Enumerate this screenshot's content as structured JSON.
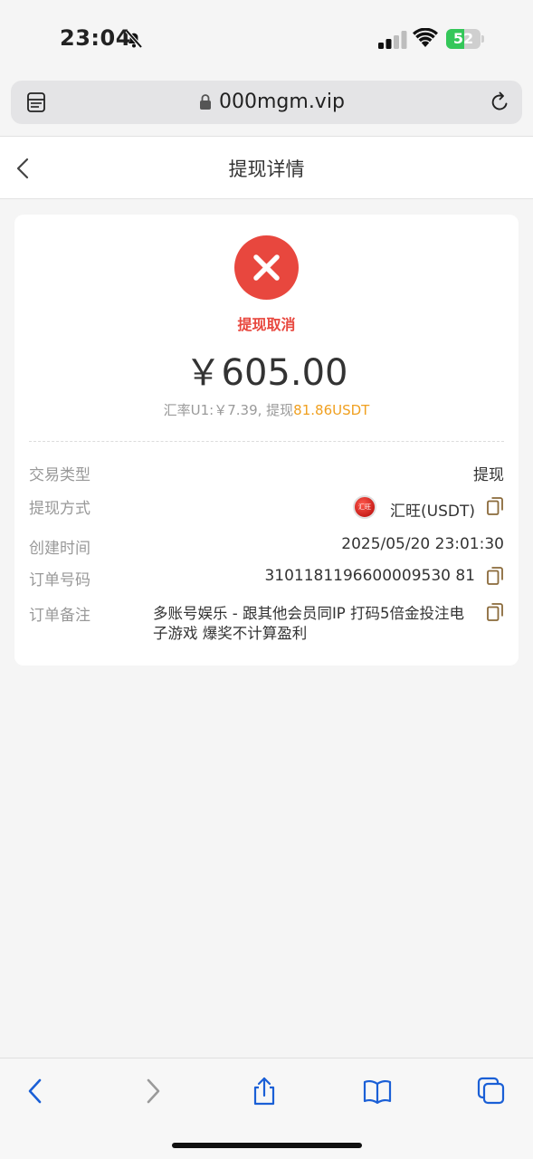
{
  "status_bar": {
    "time": "23:04",
    "battery": 52,
    "battery_label": "52"
  },
  "browser": {
    "url": "000mgm.vip"
  },
  "nav": {
    "title": "提现详情"
  },
  "detail": {
    "status": "提现取消",
    "amount": "￥605.00",
    "rate_prefix": "汇率U1:￥7.39, 提现",
    "rate_usdt": "81.86USDT",
    "rows": {
      "type": {
        "label": "交易类型",
        "value": "提现"
      },
      "method": {
        "label": "提现方式",
        "value": "汇旺(USDT)",
        "logo_text": "汇旺"
      },
      "created": {
        "label": "创建时间",
        "value": "2025/05/20 23:01:30"
      },
      "order_no": {
        "label": "订单号码",
        "value": "3101181196600009530 81"
      },
      "note": {
        "label": "订单备注",
        "value": "多账号娱乐 - 跟其他会员同IP 打码5倍金投注电子游戏 爆奖不计算盈利"
      }
    }
  },
  "colors": {
    "accent_red": "#e8473e",
    "usdt_orange": "#f0a020",
    "ios_blue": "#1a5fd6",
    "copy_brown": "#8a6a3a"
  },
  "icons": {
    "bell": "bell-slash-icon",
    "signal": "signal-icon",
    "wifi": "wifi-icon",
    "battery": "battery-charging-icon",
    "reader": "reader-mode-icon",
    "lock": "lock-icon",
    "reload": "reload-icon",
    "back": "chevron-left-icon",
    "cancel": "x-icon",
    "copy": "copy-icon",
    "browser_back": "browser-back-icon",
    "browser_forward": "browser-forward-icon",
    "share": "share-icon",
    "bookmarks": "bookmarks-icon",
    "tabs": "tabs-icon"
  }
}
